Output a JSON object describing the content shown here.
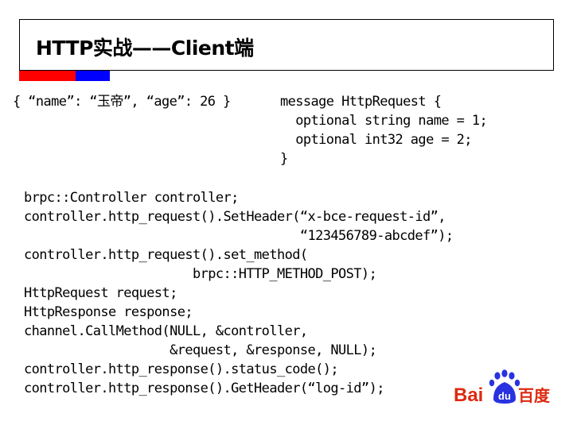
{
  "slide": {
    "title": "HTTP实战——Client端",
    "accent_colors": {
      "red": "#ff0000",
      "blue": "#0000ff"
    }
  },
  "json_example": "{ “name”: “玉帝”, “age”: 26 }",
  "proto_example": {
    "lines": [
      "message HttpRequest {",
      "  optional string name = 1;",
      "  optional int32 age = 2;",
      "}"
    ]
  },
  "cpp_code": {
    "lines": [
      "brpc::Controller controller;",
      "controller.http_request().SetHeader(“x-bce-request-id”,",
      "                                    “123456789-abcdef”);",
      "controller.http_request().set_method(",
      "                      brpc::HTTP_METHOD_POST);",
      "HttpRequest request;",
      "HttpResponse response;",
      "channel.CallMethod(NULL, &controller,",
      "                   &request, &response, NULL);",
      "controller.http_response().status_code();",
      "controller.http_response().GetHeader(“log-id”);"
    ]
  },
  "logo": {
    "name": "baidu-logo",
    "text_left": "Bai",
    "text_paw": "du",
    "text_right": "百度",
    "colors": {
      "red": "#de2910",
      "blue": "#2932e1"
    }
  }
}
